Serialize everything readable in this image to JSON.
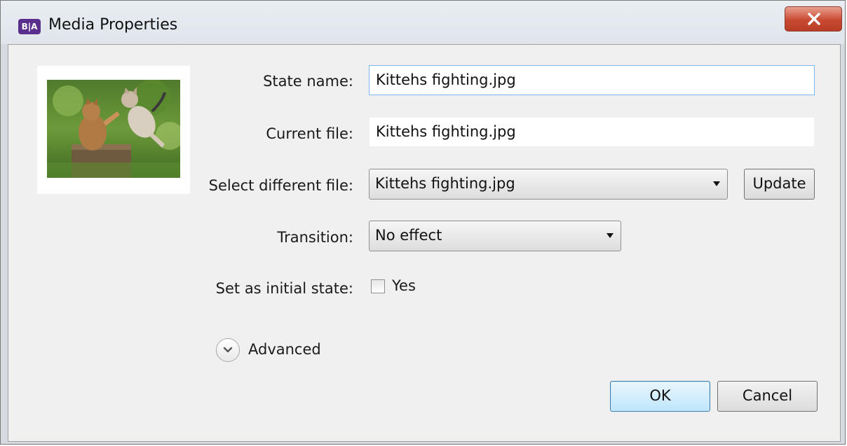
{
  "window": {
    "title": "Media Properties",
    "app_icon_text": "B|A",
    "close_icon": "close-icon"
  },
  "form": {
    "state_name_label": "State name:",
    "state_name_value": "Kittehs fighting.jpg",
    "current_file_label": "Current file:",
    "current_file_value": "Kittehs fighting.jpg",
    "select_file_label": "Select different file:",
    "select_file_value": "Kittehs fighting.jpg",
    "update_label": "Update",
    "transition_label": "Transition:",
    "transition_value": "No effect",
    "initial_state_label": "Set as initial state:",
    "initial_state_checkbox_label": "Yes",
    "initial_state_checked": false,
    "advanced_label": "Advanced"
  },
  "buttons": {
    "ok_label": "OK",
    "cancel_label": "Cancel"
  },
  "colors": {
    "app_icon": "#5a2e8c",
    "close_button": "#c94a32",
    "default_button": "#bee6fd",
    "focus_border": "#7eb4ea"
  }
}
